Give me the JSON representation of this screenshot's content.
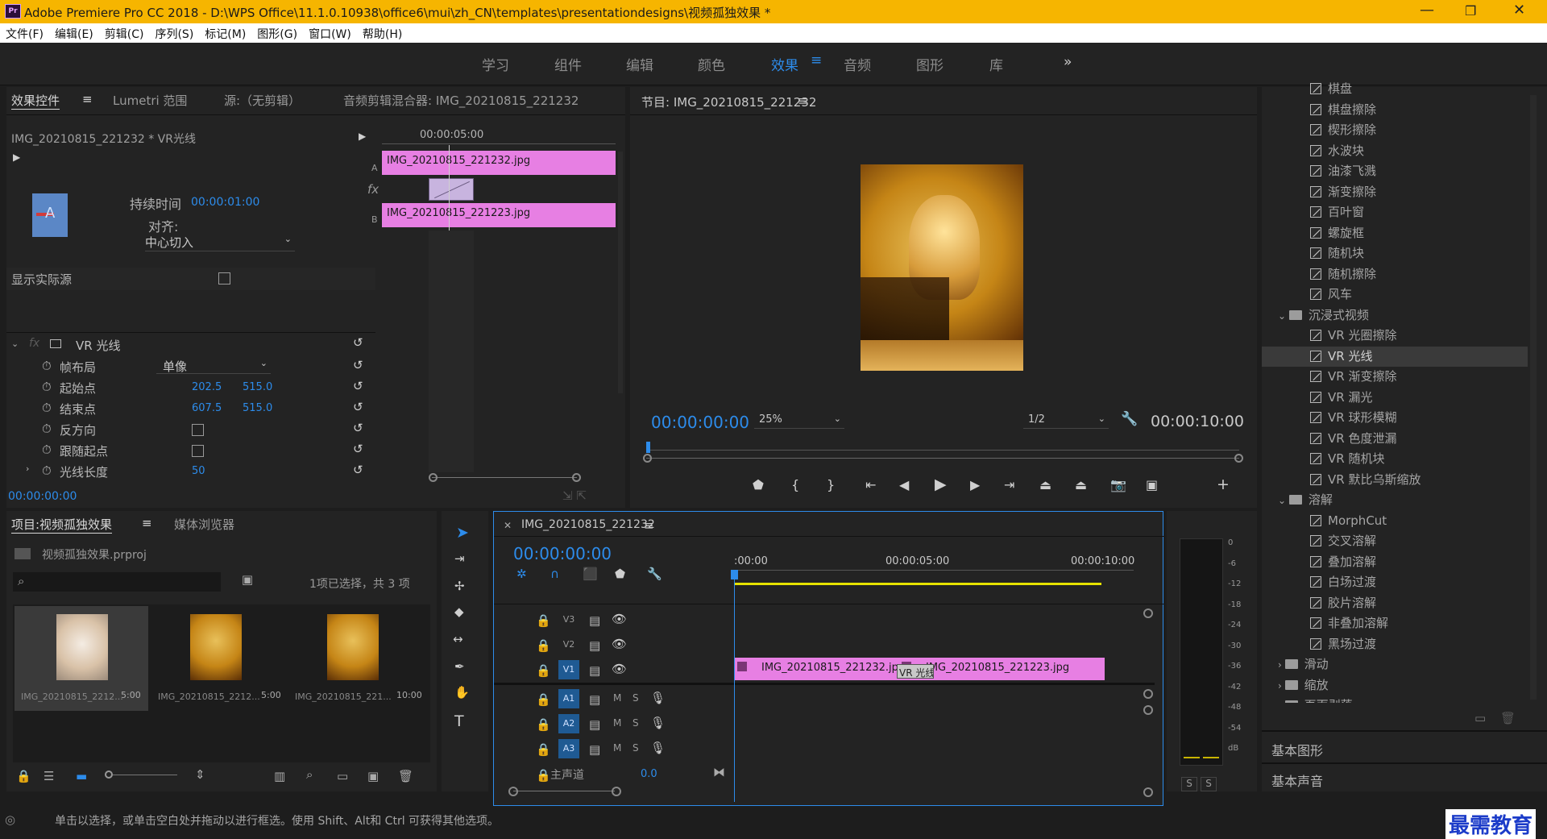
{
  "window": {
    "title": "Adobe Premiere Pro CC 2018 - D:\\WPS Office\\11.1.0.10938\\office6\\mui\\zh_CN\\templates\\presentationdesigns\\视频孤独效果 *",
    "logo": "Pr",
    "min": "—",
    "max": "❐",
    "close": "✕"
  },
  "menu": [
    "文件(F)",
    "编辑(E)",
    "剪辑(C)",
    "序列(S)",
    "标记(M)",
    "图形(G)",
    "窗口(W)",
    "帮助(H)"
  ],
  "workspaces": [
    "学习",
    "组件",
    "编辑",
    "颜色",
    "效果",
    "音频",
    "图形",
    "库"
  ],
  "workspace_active": "效果",
  "workspace_more": "»",
  "effect_controls": {
    "tabs": [
      "效果控件",
      "Lumetri 范围",
      "源:（无剪辑）",
      "音频剪辑混合器: IMG_20210815_221232"
    ],
    "clip_title": "IMG_20210815_221232 * VR光线",
    "duration_label": "持续时间",
    "duration": "00:00:01:00",
    "align_label": "对齐:",
    "align_value": "中心切入",
    "show_source": "显示实际源",
    "ruler_time": "00:00:05:00",
    "clip_a": "IMG_20210815_221232.jpg",
    "clip_b": "IMG_20210815_221223.jpg",
    "track_a": "A",
    "track_b": "B",
    "fx": "fx",
    "effect_name": "VR 光线",
    "params": [
      {
        "name": "帧布局",
        "value": "单像"
      },
      {
        "name": "起始点",
        "v1": "202.5",
        "v2": "515.0"
      },
      {
        "name": "结束点",
        "v1": "607.5",
        "v2": "515.0"
      },
      {
        "name": "反方向"
      },
      {
        "name": "跟随起点"
      },
      {
        "name": "光线长度",
        "v1": "50"
      }
    ],
    "time": "00:00:00:00"
  },
  "program": {
    "title": "节目: IMG_20210815_221232",
    "time": "00:00:00:00",
    "zoom": "25%",
    "res": "1/2",
    "duration": "00:00:10:00"
  },
  "project": {
    "tabs": [
      "项目:视频孤独效果",
      "媒体浏览器"
    ],
    "file": "视频孤独效果.prproj",
    "selection": "1项已选择，共 3 项",
    "items": [
      {
        "name": "IMG_20210815_2212...",
        "dur": "5:00"
      },
      {
        "name": "IMG_20210815_2212...",
        "dur": "5:00"
      },
      {
        "name": "IMG_20210815_221...",
        "dur": "10:00"
      }
    ]
  },
  "timeline": {
    "title": "IMG_20210815_221232",
    "time": "00:00:00:00",
    "ruler": [
      ":00:00",
      "00:00:05:00",
      "00:00:10:00"
    ],
    "video_tracks": [
      "V3",
      "V2",
      "V1"
    ],
    "audio_tracks": [
      "A1",
      "A2",
      "A3"
    ],
    "master": "主声道",
    "master_val": "0.0",
    "clip1": "IMG_20210815_221232.jpg",
    "clip2": "IMG_20210815_221223.jpg",
    "transition": "VR 光线",
    "m": "M",
    "s": "S"
  },
  "meter": {
    "ticks": [
      "0",
      "-6",
      "-12",
      "-18",
      "-24",
      "-30",
      "-36",
      "-42",
      "-48",
      "-54",
      "dB"
    ],
    "s1": "S",
    "s2": "S"
  },
  "effects": {
    "items": [
      {
        "t": "i",
        "n": "棋盘"
      },
      {
        "t": "i",
        "n": "棋盘擦除"
      },
      {
        "t": "i",
        "n": "楔形擦除"
      },
      {
        "t": "i",
        "n": "水波块"
      },
      {
        "t": "i",
        "n": "油漆飞溅"
      },
      {
        "t": "i",
        "n": "渐变擦除"
      },
      {
        "t": "i",
        "n": "百叶窗"
      },
      {
        "t": "i",
        "n": "螺旋框"
      },
      {
        "t": "i",
        "n": "随机块"
      },
      {
        "t": "i",
        "n": "随机擦除"
      },
      {
        "t": "i",
        "n": "风车"
      },
      {
        "t": "f",
        "n": "沉浸式视频",
        "open": true
      },
      {
        "t": "i",
        "n": "VR 光圈擦除"
      },
      {
        "t": "i",
        "n": "VR 光线",
        "sel": true
      },
      {
        "t": "i",
        "n": "VR 渐变擦除"
      },
      {
        "t": "i",
        "n": "VR 漏光"
      },
      {
        "t": "i",
        "n": "VR 球形模糊"
      },
      {
        "t": "i",
        "n": "VR 色度泄漏"
      },
      {
        "t": "i",
        "n": "VR 随机块"
      },
      {
        "t": "i",
        "n": "VR 默比乌斯缩放"
      },
      {
        "t": "f",
        "n": "溶解",
        "open": true
      },
      {
        "t": "i",
        "n": "MorphCut"
      },
      {
        "t": "i",
        "n": "交叉溶解"
      },
      {
        "t": "i",
        "n": "叠加溶解"
      },
      {
        "t": "i",
        "n": "白场过渡"
      },
      {
        "t": "i",
        "n": "胶片溶解"
      },
      {
        "t": "i",
        "n": "非叠加溶解"
      },
      {
        "t": "i",
        "n": "黑场过渡"
      },
      {
        "t": "f",
        "n": "滑动"
      },
      {
        "t": "f",
        "n": "缩放"
      },
      {
        "t": "f",
        "n": "页面剥落"
      }
    ],
    "sections": [
      "基本图形",
      "基本声音"
    ]
  },
  "status": "单击以选择，或单击空白处并拖动以进行框选。使用 Shift、Alt和 Ctrl 可获得其他选项。",
  "watermark": "最需教育"
}
